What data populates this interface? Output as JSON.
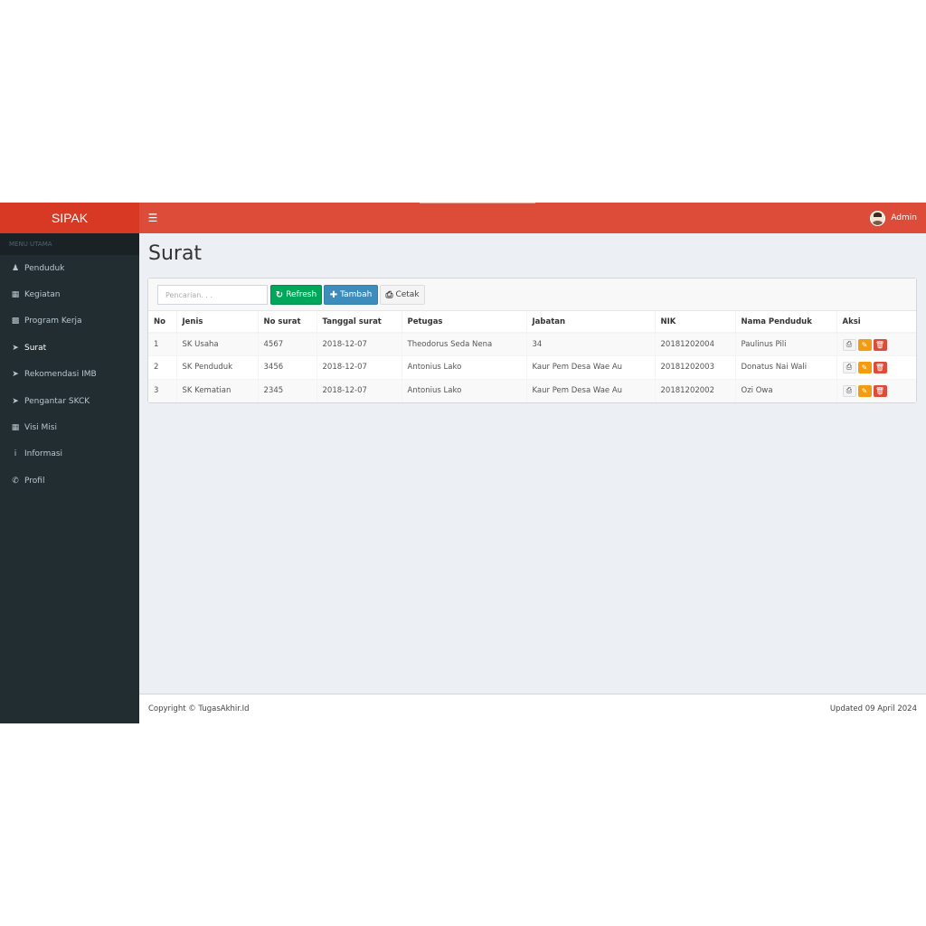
{
  "app": {
    "brand": "SIPAK"
  },
  "header": {
    "menu_icon": "hamburger-icon",
    "user_name": "Admin"
  },
  "sidebar": {
    "header": "MENU UTAMA",
    "items": [
      {
        "label": "Penduduk",
        "icon": "user-icon"
      },
      {
        "label": "Kegiatan",
        "icon": "th-large-icon"
      },
      {
        "label": "Program Kerja",
        "icon": "th-icon"
      },
      {
        "label": "Surat",
        "icon": "send-icon"
      },
      {
        "label": "Rekomendasi IMB",
        "icon": "send-icon"
      },
      {
        "label": "Pengantar SKCK",
        "icon": "send-icon"
      },
      {
        "label": "Visi Misi",
        "icon": "calendar-icon"
      },
      {
        "label": "Informasi",
        "icon": "info-icon"
      },
      {
        "label": "Profil",
        "icon": "phone-icon"
      }
    ]
  },
  "page": {
    "title": "Surat"
  },
  "toolbar": {
    "search_placeholder": "Pencarian. . .",
    "refresh_label": "Refresh",
    "add_label": "Tambah",
    "print_label": "Cetak"
  },
  "table": {
    "columns": [
      "No",
      "Jenis",
      "No surat",
      "Tanggal surat",
      "Petugas",
      "Jabatan",
      "NIK",
      "Nama Penduduk",
      "Aksi"
    ],
    "rows": [
      [
        "1",
        "SK Usaha",
        "4567",
        "2018-12-07",
        "Theodorus Seda Nena",
        "34",
        "20181202004",
        "Paulinus Pili"
      ],
      [
        "2",
        "SK Penduduk",
        "3456",
        "2018-12-07",
        "Antonius Lako",
        "Kaur Pem Desa Wae Au",
        "20181202003",
        "Donatus Nai Wali"
      ],
      [
        "3",
        "SK Kematian",
        "2345",
        "2018-12-07",
        "Antonius Lako",
        "Kaur Pem Desa Wae Au",
        "20181202002",
        "Ozi Owa"
      ]
    ]
  },
  "footer": {
    "copyright": "Copyright © TugasAkhir.Id",
    "updated": "Updated 09 April 2024"
  }
}
